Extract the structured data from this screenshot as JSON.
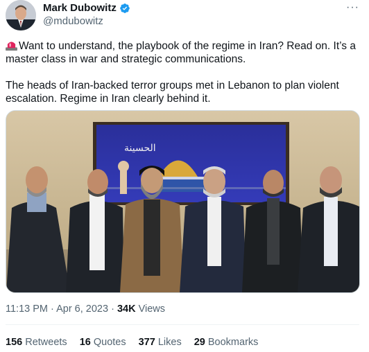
{
  "author": {
    "name": "Mark Dubowitz",
    "handle": "@mdubowitz",
    "verified": true
  },
  "tweet": {
    "paragraph1": "Want to understand, the playbook of the regime in Iran? Read on. It’s a master class in war and strategic communications.",
    "paragraph2": "The heads of Iran-backed terror groups met in Lebanon to plan violent escalation. Regime in Iran clearly behind it.",
    "emoji_icon": "siren-icon"
  },
  "media": {
    "banner_text": "الحسينة"
  },
  "meta": {
    "time": "11:13 PM",
    "separator1": " · ",
    "date": "Apr 6, 2023",
    "separator2": " · ",
    "views_count": "34K",
    "views_label": " Views"
  },
  "stats": {
    "retweets_count": "156",
    "retweets_label": " Retweets",
    "quotes_count": "16",
    "quotes_label": " Quotes",
    "likes_count": "377",
    "likes_label": " Likes",
    "bookmarks_count": "29",
    "bookmarks_label": " Bookmarks"
  },
  "colors": {
    "verified": "#1d9bf0",
    "secondary_text": "#536471",
    "primary_text": "#0f1419"
  }
}
